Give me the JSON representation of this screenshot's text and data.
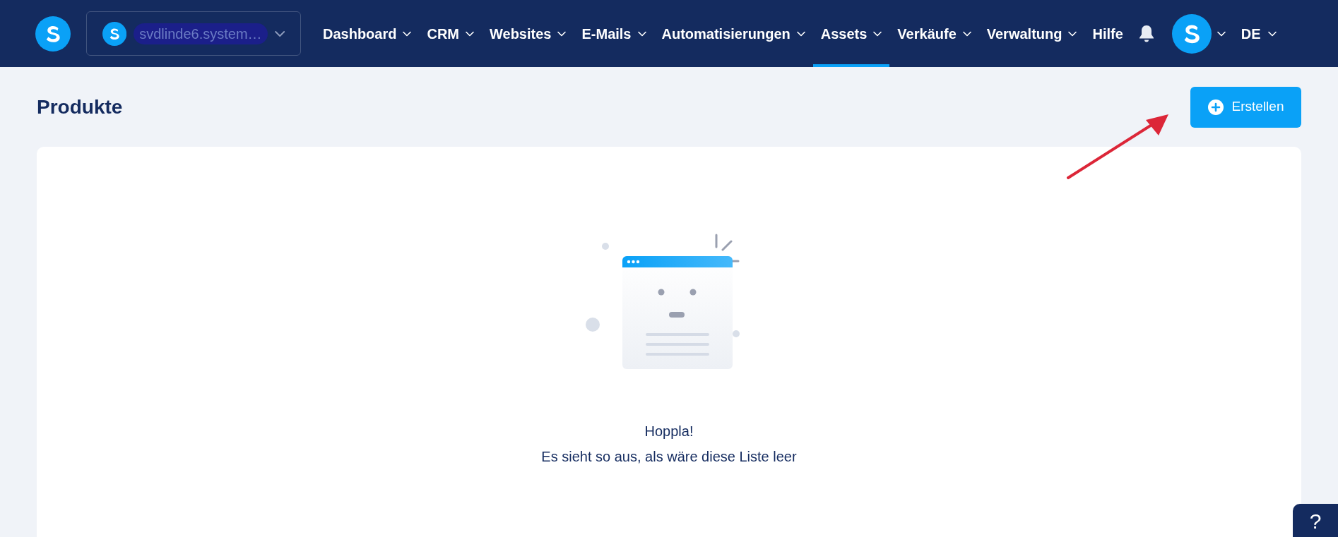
{
  "header": {
    "account": {
      "name": "svdlinde6.system…"
    },
    "nav": [
      {
        "label": "Dashboard",
        "dropdown": true,
        "selected": false
      },
      {
        "label": "CRM",
        "dropdown": true,
        "selected": false
      },
      {
        "label": "Websites",
        "dropdown": true,
        "selected": false
      },
      {
        "label": "E-Mails",
        "dropdown": true,
        "selected": false
      },
      {
        "label": "Automatisierungen",
        "dropdown": true,
        "selected": false
      },
      {
        "label": "Assets",
        "dropdown": true,
        "selected": true
      },
      {
        "label": "Verkäufe",
        "dropdown": true,
        "selected": false
      },
      {
        "label": "Verwaltung",
        "dropdown": true,
        "selected": false
      },
      {
        "label": "Hilfe",
        "dropdown": false,
        "selected": false
      }
    ],
    "language": "DE"
  },
  "page": {
    "title": "Produkte",
    "create_button": "Erstellen"
  },
  "empty_state": {
    "title": "Hoppla!",
    "message": "Es sieht so aus, als wäre diese Liste leer"
  },
  "help_button": "?"
}
